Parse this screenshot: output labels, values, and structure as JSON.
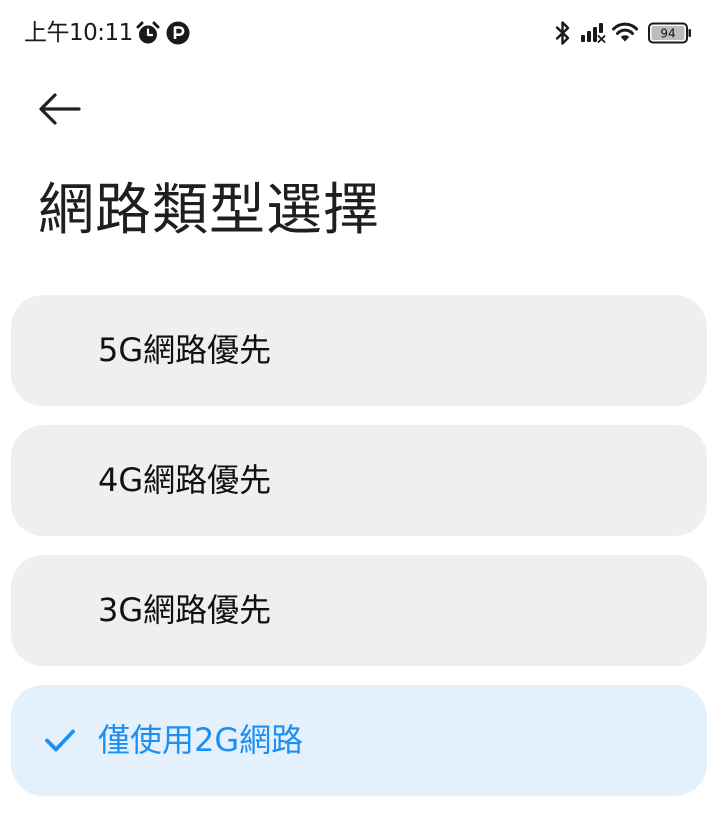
{
  "status_bar": {
    "time": "上午10:11",
    "icons": [
      "alarm-icon",
      "parking-icon",
      "bluetooth-icon",
      "signal-icon",
      "wifi-icon",
      "battery-icon"
    ],
    "battery_level": "94"
  },
  "header": {
    "back_icon": "back-arrow-icon",
    "title": "網路類型選擇"
  },
  "options": [
    {
      "label": "5G網路優先",
      "selected": false
    },
    {
      "label": "4G網路優先",
      "selected": false
    },
    {
      "label": "3G網路優先",
      "selected": false
    },
    {
      "label": "僅使用2G網路",
      "selected": true
    }
  ],
  "colors": {
    "accent": "#1d8ff0",
    "card_background": "#efefef",
    "selected_card_background": "#e4f1fd"
  }
}
